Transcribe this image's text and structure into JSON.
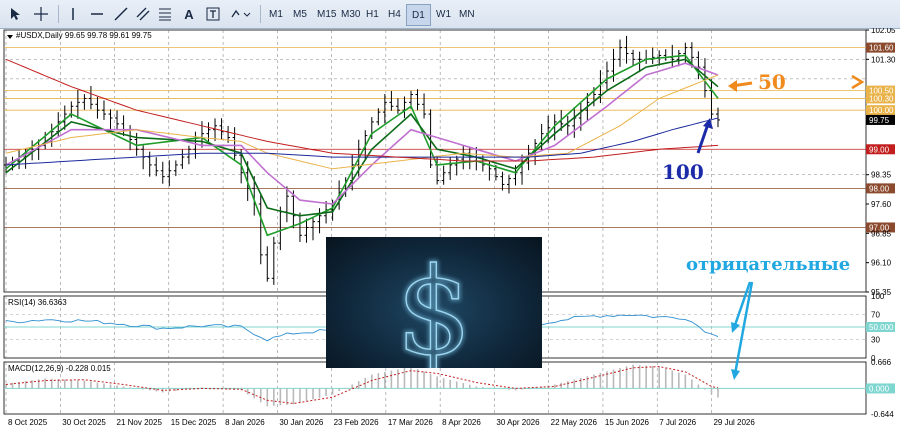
{
  "toolbar": {
    "timeframes": [
      "M1",
      "M5",
      "M15",
      "M30",
      "H1",
      "H4",
      "D1",
      "W1",
      "MN"
    ],
    "active_timeframe": "D1"
  },
  "colors": {
    "price_bars": "#000000",
    "ma_green": "#1f9d2b",
    "ma_green_dark": "#0b6b17",
    "ma_violet": "#c070d0",
    "ma_orange": "#e9b34a",
    "ma_blue": "#1b2a9c",
    "ma_red": "#c21e1e",
    "rsi_line": "#2f8fd0",
    "macd_hist": "#b9b9b9",
    "macd_signal": "#c21e1e",
    "annotation_orange": "#f08a1c",
    "annotation_blue": "#1b2aa8",
    "annotation_cyan": "#22a8e0",
    "level_line": "#8b4a2e"
  },
  "chart_data": [
    {
      "type": "line",
      "title": "#USDX,Daily",
      "ohlc_text": "99.65 99.78 99.61 99.75",
      "x_ticks": [
        "8 Oct 2025",
        "30 Oct 2025",
        "21 Nov 2025",
        "15 Dec 2025",
        "8 Jan 2026",
        "30 Jan 2026",
        "23 Feb 2026",
        "17 Mar 2026",
        "8 Apr 2026",
        "30 Apr 2026",
        "22 May 2026",
        "15 Jun 2026",
        "7 Jul 2026",
        "29 Jul 2026"
      ],
      "y_ticks": [
        102.05,
        101.6,
        101.3,
        100.5,
        100.3,
        100.0,
        99.75,
        99.0,
        98.35,
        98.0,
        97.6,
        97.0,
        96.85,
        96.1,
        95.35
      ],
      "ylim": [
        95.35,
        102.05
      ],
      "last_price": 99.75,
      "levels": [
        101.6,
        100.5,
        100.3,
        100.0,
        99.0,
        98.0,
        97.0
      ],
      "price_path": [
        [
          0,
          98.6
        ],
        [
          3,
          98.9
        ],
        [
          6,
          99.2
        ],
        [
          8,
          99.7
        ],
        [
          10,
          100.1
        ],
        [
          12,
          100.3
        ],
        [
          14,
          100.0
        ],
        [
          16,
          99.8
        ],
        [
          18,
          99.5
        ],
        [
          20,
          99.0
        ],
        [
          22,
          98.6
        ],
        [
          24,
          98.3
        ],
        [
          26,
          98.6
        ],
        [
          28,
          99.0
        ],
        [
          30,
          99.4
        ],
        [
          32,
          99.6
        ],
        [
          34,
          99.3
        ],
        [
          36,
          98.4
        ],
        [
          38,
          97.6
        ],
        [
          39,
          96.3
        ],
        [
          40,
          95.7
        ],
        [
          41,
          96.6
        ],
        [
          42,
          97.4
        ],
        [
          43,
          97.8
        ],
        [
          44,
          97.3
        ],
        [
          45,
          96.8
        ],
        [
          46,
          97.0
        ],
        [
          48,
          97.3
        ],
        [
          50,
          97.6
        ],
        [
          52,
          98.2
        ],
        [
          54,
          99.0
        ],
        [
          56,
          99.7
        ],
        [
          58,
          100.2
        ],
        [
          60,
          100.0
        ],
        [
          62,
          100.4
        ],
        [
          64,
          99.9
        ],
        [
          65,
          98.6
        ],
        [
          66,
          98.2
        ],
        [
          68,
          98.6
        ],
        [
          70,
          98.9
        ],
        [
          72,
          98.7
        ],
        [
          74,
          98.5
        ],
        [
          76,
          98.1
        ],
        [
          78,
          98.4
        ],
        [
          80,
          98.9
        ],
        [
          82,
          99.4
        ],
        [
          84,
          99.7
        ],
        [
          86,
          99.6
        ],
        [
          88,
          100.0
        ],
        [
          90,
          100.4
        ],
        [
          92,
          101.0
        ],
        [
          94,
          101.6
        ],
        [
          96,
          101.3
        ],
        [
          98,
          101.3
        ],
        [
          100,
          101.4
        ],
        [
          102,
          101.3
        ],
        [
          104,
          101.6
        ],
        [
          106,
          101.1
        ],
        [
          107,
          100.5
        ],
        [
          108,
          99.9
        ],
        [
          109,
          99.75
        ]
      ],
      "moving_averages": [
        {
          "period": 5,
          "points": [
            [
              0,
              98.5
            ],
            [
              10,
              99.9
            ],
            [
              20,
              99.1
            ],
            [
              30,
              99.3
            ],
            [
              36,
              98.6
            ],
            [
              40,
              96.8
            ],
            [
              45,
              97.1
            ],
            [
              50,
              97.5
            ],
            [
              56,
              99.4
            ],
            [
              62,
              100.1
            ],
            [
              66,
              98.6
            ],
            [
              72,
              98.7
            ],
            [
              78,
              98.4
            ],
            [
              84,
              99.6
            ],
            [
              92,
              100.8
            ],
            [
              98,
              101.3
            ],
            [
              104,
              101.4
            ],
            [
              109,
              100.3
            ]
          ]
        },
        {
          "period": 10,
          "points": [
            [
              0,
              98.4
            ],
            [
              10,
              99.7
            ],
            [
              20,
              99.3
            ],
            [
              30,
              99.2
            ],
            [
              36,
              98.9
            ],
            [
              40,
              97.5
            ],
            [
              45,
              97.3
            ],
            [
              50,
              97.4
            ],
            [
              56,
              99.0
            ],
            [
              62,
              99.9
            ],
            [
              66,
              99.0
            ],
            [
              72,
              98.8
            ],
            [
              78,
              98.5
            ],
            [
              84,
              99.4
            ],
            [
              92,
              100.5
            ],
            [
              98,
              101.1
            ],
            [
              104,
              101.3
            ],
            [
              109,
              100.6
            ]
          ]
        },
        {
          "period": 20,
          "points": [
            [
              0,
              98.6
            ],
            [
              10,
              99.5
            ],
            [
              20,
              99.5
            ],
            [
              30,
              99.1
            ],
            [
              36,
              99.1
            ],
            [
              40,
              98.4
            ],
            [
              45,
              97.7
            ],
            [
              50,
              97.6
            ],
            [
              56,
              98.6
            ],
            [
              62,
              99.5
            ],
            [
              66,
              99.3
            ],
            [
              72,
              99.0
            ],
            [
              78,
              98.7
            ],
            [
              84,
              99.1
            ],
            [
              92,
              100.1
            ],
            [
              98,
              100.9
            ],
            [
              104,
              101.2
            ],
            [
              109,
              100.9
            ]
          ]
        },
        {
          "period": 50,
          "points": [
            [
              0,
              98.9
            ],
            [
              10,
              99.3
            ],
            [
              20,
              99.5
            ],
            [
              30,
              99.3
            ],
            [
              36,
              99.2
            ],
            [
              40,
              98.9
            ],
            [
              50,
              98.5
            ],
            [
              60,
              98.7
            ],
            [
              70,
              98.9
            ],
            [
              78,
              98.8
            ],
            [
              86,
              98.9
            ],
            [
              94,
              99.6
            ],
            [
              100,
              100.3
            ],
            [
              106,
              100.7
            ],
            [
              109,
              100.9
            ]
          ]
        },
        {
          "period": 100,
          "points": [
            [
              0,
              98.6
            ],
            [
              10,
              98.7
            ],
            [
              20,
              98.8
            ],
            [
              30,
              98.9
            ],
            [
              40,
              98.9
            ],
            [
              50,
              98.8
            ],
            [
              60,
              98.8
            ],
            [
              70,
              98.8
            ],
            [
              80,
              98.8
            ],
            [
              88,
              98.9
            ],
            [
              96,
              99.2
            ],
            [
              102,
              99.5
            ],
            [
              109,
              99.8
            ]
          ]
        },
        {
          "period": 200,
          "points": [
            [
              0,
              101.3
            ],
            [
              10,
              100.6
            ],
            [
              20,
              100.0
            ],
            [
              30,
              99.6
            ],
            [
              40,
              99.2
            ],
            [
              50,
              98.9
            ],
            [
              60,
              98.8
            ],
            [
              70,
              98.7
            ],
            [
              80,
              98.7
            ],
            [
              90,
              98.8
            ],
            [
              100,
              99.0
            ],
            [
              109,
              99.1
            ]
          ]
        }
      ]
    },
    {
      "type": "line",
      "title": "RSI(14) 36.6363",
      "ylim": [
        0,
        100
      ],
      "y_ticks": [
        100,
        70,
        50,
        30,
        0
      ],
      "last_value": 36.6363,
      "points": [
        [
          0,
          58
        ],
        [
          6,
          62
        ],
        [
          12,
          60
        ],
        [
          18,
          55
        ],
        [
          24,
          48
        ],
        [
          30,
          52
        ],
        [
          36,
          50
        ],
        [
          40,
          30
        ],
        [
          44,
          40
        ],
        [
          50,
          45
        ],
        [
          56,
          60
        ],
        [
          62,
          58
        ],
        [
          66,
          44
        ],
        [
          72,
          50
        ],
        [
          78,
          45
        ],
        [
          84,
          60
        ],
        [
          90,
          68
        ],
        [
          96,
          70
        ],
        [
          100,
          66
        ],
        [
          104,
          65
        ],
        [
          108,
          38
        ],
        [
          109,
          37
        ]
      ]
    },
    {
      "type": "bar",
      "title": "MACD(12,26,9) -0.228 0.015",
      "ylim": [
        -0.644,
        0.666
      ],
      "y_ticks": [
        0.666,
        0.0,
        -0.644
      ],
      "histogram": [
        [
          0,
          0.12
        ],
        [
          6,
          0.25
        ],
        [
          12,
          0.2
        ],
        [
          18,
          0.05
        ],
        [
          24,
          -0.1
        ],
        [
          30,
          0.02
        ],
        [
          36,
          -0.05
        ],
        [
          40,
          -0.45
        ],
        [
          44,
          -0.4
        ],
        [
          50,
          -0.15
        ],
        [
          56,
          0.35
        ],
        [
          62,
          0.55
        ],
        [
          66,
          0.3
        ],
        [
          72,
          0.05
        ],
        [
          78,
          -0.05
        ],
        [
          84,
          0.1
        ],
        [
          90,
          0.35
        ],
        [
          96,
          0.6
        ],
        [
          100,
          0.55
        ],
        [
          104,
          0.35
        ],
        [
          108,
          -0.15
        ],
        [
          109,
          -0.228
        ]
      ],
      "signal": [
        [
          0,
          0.1
        ],
        [
          6,
          0.2
        ],
        [
          12,
          0.22
        ],
        [
          18,
          0.1
        ],
        [
          24,
          -0.05
        ],
        [
          30,
          0.0
        ],
        [
          36,
          -0.02
        ],
        [
          40,
          -0.3
        ],
        [
          44,
          -0.38
        ],
        [
          50,
          -0.22
        ],
        [
          56,
          0.2
        ],
        [
          62,
          0.45
        ],
        [
          66,
          0.38
        ],
        [
          72,
          0.15
        ],
        [
          78,
          0.0
        ],
        [
          84,
          0.05
        ],
        [
          90,
          0.28
        ],
        [
          96,
          0.52
        ],
        [
          100,
          0.55
        ],
        [
          104,
          0.42
        ],
        [
          108,
          0.05
        ],
        [
          109,
          0.015
        ]
      ]
    }
  ],
  "annotations": {
    "label_50": "50",
    "label_100": "100",
    "label_negative": "отрицательные"
  },
  "image_overlay": {
    "glyph": "$"
  }
}
